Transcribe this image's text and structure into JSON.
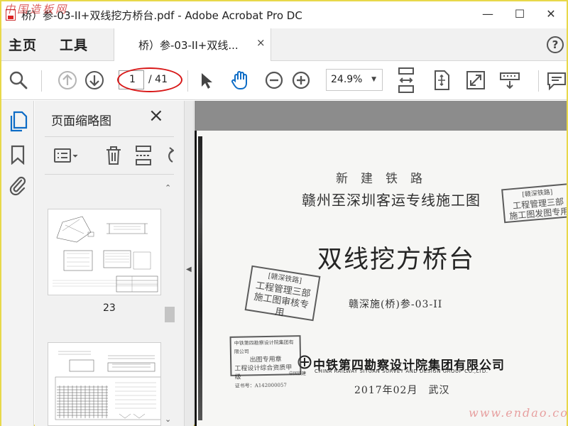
{
  "window": {
    "title": "桥）参-03-II+双线挖方桥台.pdf - Adobe Acrobat Pro DC",
    "minimize_glyph": "—",
    "maximize_glyph": "☐",
    "close_glyph": "✕"
  },
  "watermarks": {
    "top": "中国造板网",
    "bottom": "www.endao.com"
  },
  "tabbar": {
    "home": "主页",
    "tools": "工具",
    "doc_tab": "桥）参-03-II+双线...",
    "doc_tab_close": "×",
    "help": "?"
  },
  "toolbar": {
    "current_page": "1",
    "total_pages": "/ 41",
    "zoom": "24.9%",
    "icons": [
      "search-icon",
      "previous-page-icon",
      "next-page-icon",
      "select-cursor-icon",
      "hand-tool-icon",
      "zoom-out-icon",
      "zoom-in-icon",
      "scroll-mode-icon",
      "fit-page-icon",
      "full-screen-icon",
      "read-mode-icon",
      "comment-icon"
    ],
    "accent_color": "#0d6cc6",
    "highlight_color": "#d81818"
  },
  "left_rail": {
    "icons": [
      "page-thumbnails-icon",
      "bookmarks-icon",
      "attachments-icon"
    ]
  },
  "thumbnail_panel": {
    "title": "页面缩略图",
    "close": "×",
    "tool_icons": [
      "thumbnail-options-icon",
      "delete-page-icon",
      "insert-page-icon",
      "rotate-page-icon"
    ],
    "pages": [
      {
        "label": "23"
      },
      {
        "label": ""
      }
    ]
  },
  "document": {
    "line1": "新建铁路",
    "line2": "赣州至深圳客运专线施工图",
    "title": "双线挖方桥台",
    "code": "赣深施(桥)参-03-II",
    "company": "中铁第四勘察设计院集团有限公司",
    "company_en": "CHINA RAILWAY SIYUAN SURVEY AND DESIGN GROUP CO.,LTD.",
    "logo_caption": "中国铁建",
    "date": "2017年02月　武汉",
    "stamp_right": [
      "[赣深铁路]",
      "工程管理三部",
      "施工图发图专用"
    ],
    "stamp_left": [
      "[赣深铁路]",
      "工程管理三部",
      "施工图审核专用"
    ],
    "stamp_small": [
      "中铁第四勘察设计院集团有限公司",
      "出图专用章",
      "工程设计综合资质甲级",
      "证书号：A142000057"
    ]
  }
}
